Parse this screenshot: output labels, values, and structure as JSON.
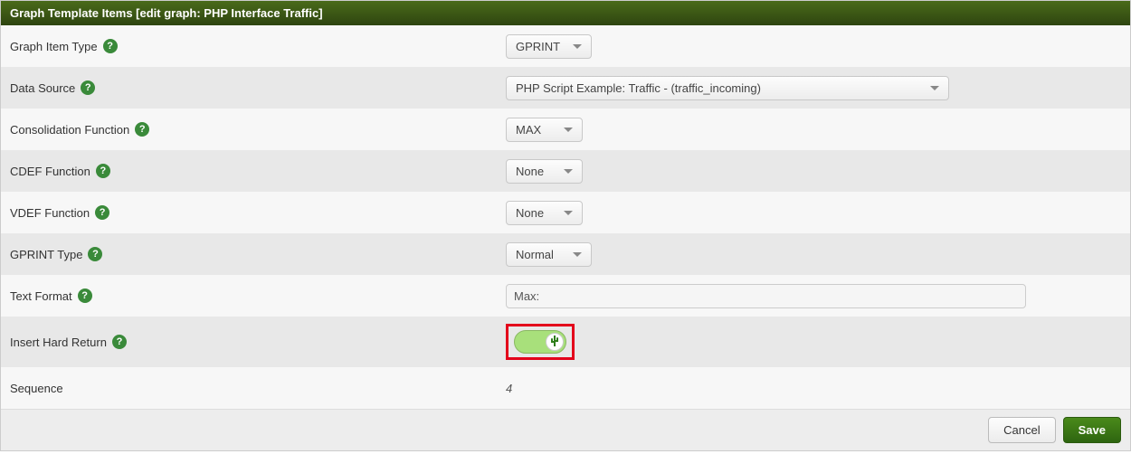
{
  "header": {
    "title": "Graph Template Items [edit graph: PHP Interface Traffic]"
  },
  "rows": {
    "graph_item_type": {
      "label": "Graph Item Type",
      "value": "GPRINT"
    },
    "data_source": {
      "label": "Data Source",
      "value": "PHP Script Example: Traffic - (traffic_incoming)"
    },
    "consolidation": {
      "label": "Consolidation Function",
      "value": "MAX"
    },
    "cdef": {
      "label": "CDEF Function",
      "value": "None"
    },
    "vdef": {
      "label": "VDEF Function",
      "value": "None"
    },
    "gprint_type": {
      "label": "GPRINT Type",
      "value": "Normal"
    },
    "text_format": {
      "label": "Text Format",
      "value": "Max:"
    },
    "hard_return": {
      "label": "Insert Hard Return",
      "on": true
    },
    "sequence": {
      "label": "Sequence",
      "value": "4"
    }
  },
  "footer": {
    "cancel": "Cancel",
    "save": "Save"
  },
  "help_glyph": "?"
}
